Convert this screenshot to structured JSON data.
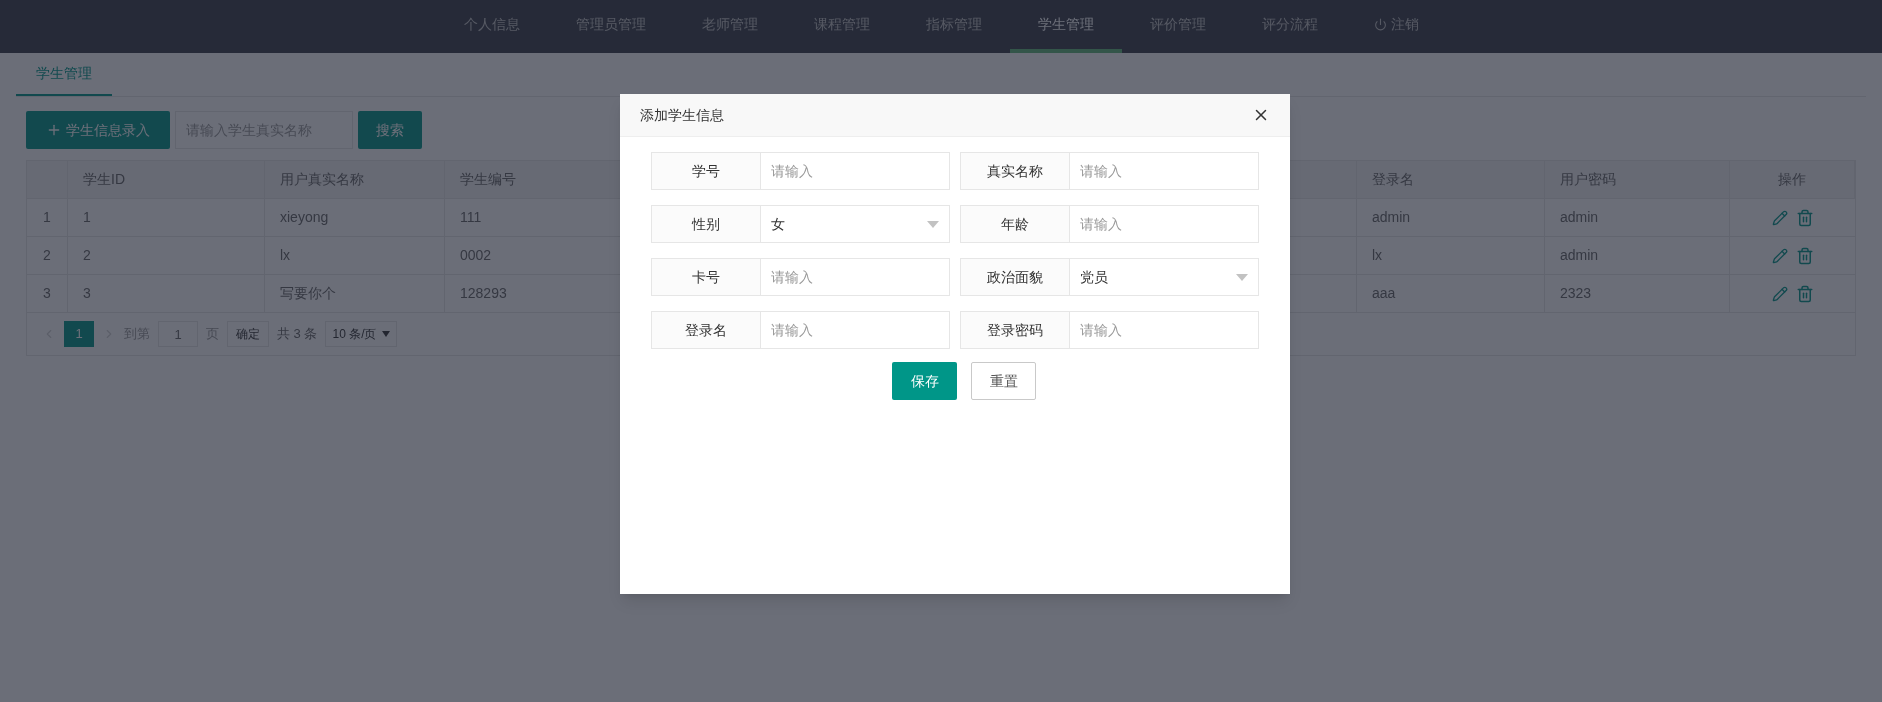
{
  "nav": {
    "items": [
      {
        "label": "个人信息",
        "selected": false,
        "kind": "link"
      },
      {
        "label": "管理员管理",
        "selected": false,
        "kind": "link"
      },
      {
        "label": "老师管理",
        "selected": false,
        "kind": "link"
      },
      {
        "label": "课程管理",
        "selected": false,
        "kind": "link"
      },
      {
        "label": "指标管理",
        "selected": false,
        "kind": "link"
      },
      {
        "label": "学生管理",
        "selected": true,
        "kind": "link"
      },
      {
        "label": "评价管理",
        "selected": false,
        "kind": "link"
      },
      {
        "label": "评分流程",
        "selected": false,
        "kind": "link"
      },
      {
        "label": "注销",
        "selected": false,
        "kind": "logout"
      }
    ]
  },
  "page_tabs": [
    {
      "label": "学生管理",
      "selected": true
    }
  ],
  "toolbar": {
    "add_button": "学生信息录入",
    "search": {
      "placeholder": "请输入学生真实名称"
    },
    "search_button": "搜索"
  },
  "table": {
    "columns": [
      "",
      "学生ID",
      "用户真实名称",
      "学生编号",
      "登录名",
      "用户密码",
      "操作"
    ],
    "rows": [
      {
        "cells": [
          "1",
          "1",
          "xieyong",
          "111",
          "admin",
          "admin"
        ]
      },
      {
        "cells": [
          "2",
          "2",
          "lx",
          "0002",
          "lx",
          "admin"
        ]
      },
      {
        "cells": [
          "3",
          "3",
          "写要你个",
          "128293",
          "aaa",
          "2323"
        ]
      }
    ]
  },
  "pagination": {
    "prev_disabled": true,
    "pages": [
      {
        "label": "1",
        "selected": true
      }
    ],
    "goto_label": "到第",
    "goto_value": "1",
    "page_unit": "页",
    "confirm": "确定",
    "total": "共 3 条",
    "page_size": "10 条/页"
  },
  "dialog": {
    "title": "添加学生信息",
    "fields": [
      {
        "label": "学号",
        "kind": "input",
        "placeholder": "请输入"
      },
      {
        "label": "真实名称",
        "kind": "input",
        "placeholder": "请输入"
      },
      {
        "label": "性别",
        "kind": "select",
        "value": "女"
      },
      {
        "label": "年龄",
        "kind": "input",
        "placeholder": "请输入"
      },
      {
        "label": "卡号",
        "kind": "input",
        "placeholder": "请输入"
      },
      {
        "label": "政治面貌",
        "kind": "select",
        "value": "党员"
      },
      {
        "label": "登录名",
        "kind": "input",
        "placeholder": "请输入"
      },
      {
        "label": "登录密码",
        "kind": "input",
        "placeholder": "请输入"
      }
    ],
    "buttons": [
      {
        "label": "保存",
        "kind": "primary"
      },
      {
        "label": "重置",
        "kind": "default"
      }
    ]
  }
}
